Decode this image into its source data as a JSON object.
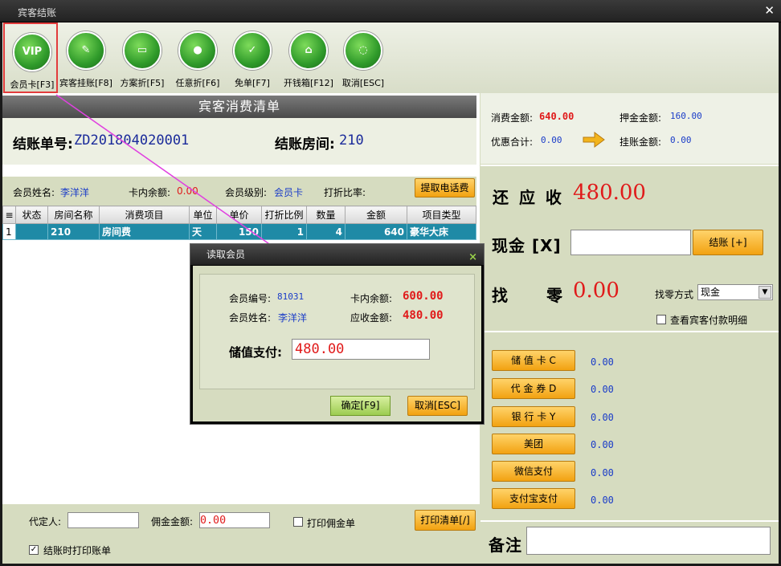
{
  "window": {
    "title": "宾客结账"
  },
  "toolbar": [
    {
      "label": "会员卡[F3]",
      "glyph": "VIP"
    },
    {
      "label": "宾客挂账[F8]",
      "glyph": "✎"
    },
    {
      "label": "方案折[F5]",
      "glyph": "▭"
    },
    {
      "label": "任意折[F6]",
      "glyph": "●"
    },
    {
      "label": "免单[F7]",
      "glyph": "✓"
    },
    {
      "label": "开钱箱[F12]",
      "glyph": "⌂"
    },
    {
      "label": "取消[ESC]",
      "glyph": "◌"
    }
  ],
  "bill": {
    "header": "宾客消费清单",
    "order_label": "结账单号:",
    "order_no": "ZD201804020001",
    "room_label": "结账房间:",
    "room_no": "210",
    "member_name_label": "会员姓名:",
    "member_name": "李洋洋",
    "card_balance_label": "卡内余额:",
    "card_balance": "0.00",
    "member_level_label": "会员级别:",
    "member_level": "会员卡",
    "discount_label": "打折比率:",
    "fetch_phone_btn": "提取电话费",
    "columns": [
      "状态",
      "房间名称",
      "消费项目",
      "单位",
      "单价",
      "打折比例",
      "数量",
      "金额",
      "项目类型"
    ],
    "rows": [
      {
        "idx": "1",
        "status": "",
        "room": "210",
        "item": "房间费",
        "unit": "天",
        "price": "150",
        "discount": "1",
        "qty": "4",
        "amount": "640",
        "type": "豪华大床"
      }
    ]
  },
  "bottom": {
    "booker_label": "代定人:",
    "booker_value": "",
    "commission_label": "佣金金额:",
    "commission_value": "0.00",
    "print_commission_label": "打印佣金单",
    "print_commission_checked": false,
    "print_list_btn": "打印清单[/]",
    "print_on_checkout_label": "结账时打印账单",
    "print_on_checkout_checked": true
  },
  "summary": {
    "consume_label": "消费金额:",
    "consume": "640.00",
    "deposit_label": "押金金额:",
    "deposit": "160.00",
    "discount_total_label": "优惠合计:",
    "discount_total": "0.00",
    "onaccount_label": "挂账金额:",
    "onaccount": "0.00",
    "receivable_label": "还 应 收",
    "receivable": "480.00",
    "cash_label": "现金 [X]",
    "cash_value": "",
    "checkout_btn": "结账 [+]",
    "change_label_a": "找",
    "change_label_b": "零",
    "change": "0.00",
    "change_mode_label": "找零方式",
    "change_mode": "现金",
    "view_detail_label": "查看宾客付款明细",
    "view_detail_checked": false,
    "remark_label": "备注",
    "remark_value": ""
  },
  "payments": [
    {
      "label": "储 值 卡 C",
      "value": "0.00"
    },
    {
      "label": "代 金 券 D",
      "value": "0.00"
    },
    {
      "label": "银 行 卡 Y",
      "value": "0.00"
    },
    {
      "label": "美团",
      "value": "0.00"
    },
    {
      "label": "微信支付",
      "value": "0.00"
    },
    {
      "label": "支付宝支付",
      "value": "0.00"
    }
  ],
  "dialog": {
    "title": "读取会员",
    "close": "×",
    "member_no_label": "会员编号:",
    "member_no": "81031",
    "card_balance_label": "卡内余额:",
    "card_balance": "600.00",
    "member_name_label": "会员姓名:",
    "member_name": "李洋洋",
    "receivable_label": "应收金额:",
    "receivable": "480.00",
    "stored_pay_label": "储值支付:",
    "stored_pay_value": "480.00",
    "ok_btn": "确定[F9]",
    "cancel_btn": "取消[ESC]"
  },
  "colors": {
    "accent_orange": "#f2a211",
    "money_red": "#e01a1a",
    "value_blue": "#1a3cc8",
    "row_selected": "#1f8aa6",
    "arrow_magenta": "#e040e0"
  }
}
